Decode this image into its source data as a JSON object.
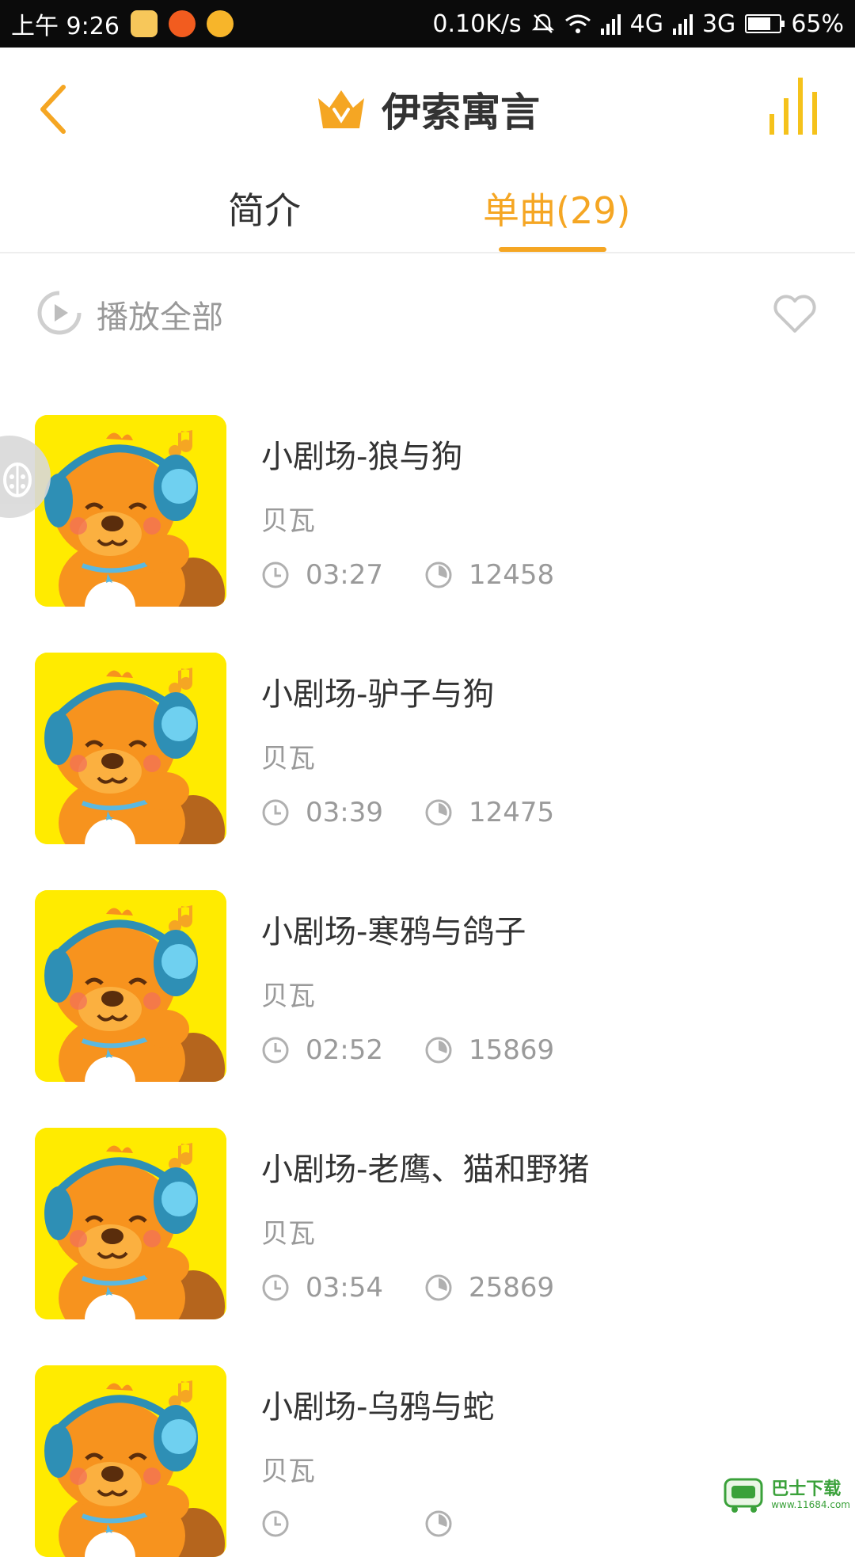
{
  "status_bar": {
    "time": "上午 9:26",
    "speed": "0.10K/s",
    "net1": "4G",
    "net2": "3G",
    "battery": "65%"
  },
  "header": {
    "title": "伊索寓言",
    "back_icon": "chevron-left-icon",
    "crown_icon": "crown-vip-icon",
    "player_icon": "equalizer-icon"
  },
  "tabs": [
    {
      "label": "简介",
      "active": false
    },
    {
      "label": "单曲(29)",
      "active": true
    }
  ],
  "play_all": {
    "label": "播放全部"
  },
  "songs": [
    {
      "title": "小剧场-狼与狗",
      "artist": "贝瓦",
      "duration": "03:27",
      "plays": "12458"
    },
    {
      "title": "小剧场-驴子与狗",
      "artist": "贝瓦",
      "duration": "03:39",
      "plays": "12475"
    },
    {
      "title": "小剧场-寒鸦与鸽子",
      "artist": "贝瓦",
      "duration": "02:52",
      "plays": "15869"
    },
    {
      "title": "小剧场-老鹰、猫和野猪",
      "artist": "贝瓦",
      "duration": "03:54",
      "plays": "25869"
    },
    {
      "title": "小剧场-乌鸦与蛇",
      "artist": "贝瓦",
      "duration": "",
      "plays": ""
    }
  ],
  "watermark": {
    "name": "巴士下载",
    "url": "www.11684.com"
  },
  "colors": {
    "accent": "#f5a623",
    "cover_bg": "#ffeb00"
  }
}
